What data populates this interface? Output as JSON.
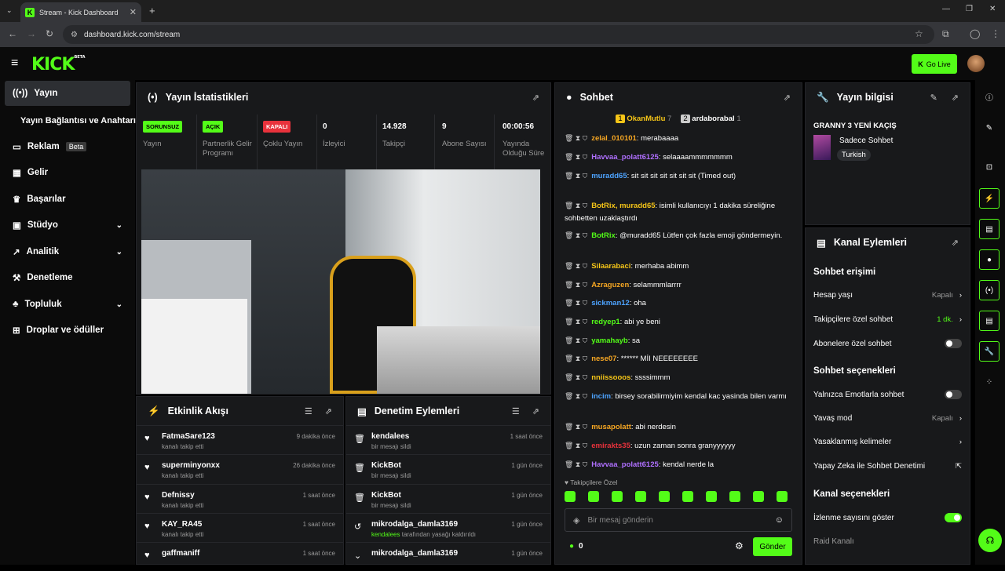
{
  "browser": {
    "tab_title": "Stream - Kick Dashboard",
    "url": "dashboard.kick.com/stream"
  },
  "top": {
    "logo": "KICK",
    "logo_beta": "BETA",
    "go_live": "Go Live"
  },
  "sidebar": {
    "items": [
      {
        "label": "Yayın",
        "icon": "broadcast-icon"
      },
      {
        "label": "Yayın Bağlantısı ve Anahtarı",
        "icon": ""
      },
      {
        "label": "Reklam",
        "icon": "ad-icon",
        "badge": "Beta"
      },
      {
        "label": "Gelir",
        "icon": "revenue-icon"
      },
      {
        "label": "Başarılar",
        "icon": "trophy-icon"
      },
      {
        "label": "Stüdyo",
        "icon": "studio-icon"
      },
      {
        "label": "Analitik",
        "icon": "analytics-icon"
      },
      {
        "label": "Denetleme",
        "icon": "moderation-icon"
      },
      {
        "label": "Topluluk",
        "icon": "community-icon"
      },
      {
        "label": "Droplar ve ödüller",
        "icon": "drops-icon"
      }
    ]
  },
  "stats": {
    "title": "Yayın İstatistikleri",
    "items": [
      {
        "value": "SORUNSUZ",
        "label": "Yayın",
        "color": "#53fc18"
      },
      {
        "value": "AÇIK",
        "label": "Partnerlik Gelir Programı",
        "color": "#53fc18"
      },
      {
        "value": "KAPALI",
        "label": "Çoklu Yayın",
        "color": "#e8323c"
      },
      {
        "value": "0",
        "label": "İzleyici"
      },
      {
        "value": "14.928",
        "label": "Takipçi"
      },
      {
        "value": "9",
        "label": "Abone Sayısı"
      },
      {
        "value": "00:00:56",
        "label": "Yayında Olduğu Süre"
      }
    ]
  },
  "activity": {
    "title": "Etkinlik Akışı",
    "items": [
      {
        "name": "FatmaSare123",
        "sub": "kanalı takip etti",
        "time": "9 dakika önce"
      },
      {
        "name": "superminyonxx",
        "sub": "kanalı takip etti",
        "time": "26 dakika önce"
      },
      {
        "name": "Defnissy",
        "sub": "kanalı takip etti",
        "time": "1 saat önce"
      },
      {
        "name": "KAY_RA45",
        "sub": "kanalı takip etti",
        "time": "1 saat önce"
      },
      {
        "name": "gaffmaniff",
        "sub": "",
        "time": "1 saat önce"
      }
    ]
  },
  "modlog": {
    "title": "Denetim Eylemleri",
    "items": [
      {
        "name": "kendalees",
        "sub": "bir mesajı sildi",
        "time": "1 saat önce"
      },
      {
        "name": "KickBot",
        "sub": "bir mesajı sildi",
        "time": "1 gün önce"
      },
      {
        "name": "KickBot",
        "sub": "bir mesajı sildi",
        "time": "1 gün önce"
      },
      {
        "name": "mikrodalga_damla3169",
        "sub_user": "kendalees",
        "sub": "tarafından yasağı kaldırıldı",
        "time": "1 gün önce"
      },
      {
        "name": "mikrodalga_damla3169",
        "sub": "",
        "time": "1 gün önce"
      }
    ]
  },
  "chat": {
    "title": "Sohbet",
    "pinned": [
      {
        "name": "OkanMutlu",
        "count": "7"
      },
      {
        "name": "ardaborabal",
        "count": "1"
      }
    ],
    "messages": [
      {
        "user": "zelal_010101",
        "color": "#f5a623",
        "text": "merabaaaa"
      },
      {
        "user": "Havvaa_polatt6125",
        "color": "#b070ff",
        "text": "selaaaammmmmmm"
      },
      {
        "user": "muradd65",
        "color": "#4da3ff",
        "text": "sit sit sit sit sit sit sit (Timed out)"
      },
      {
        "user": "BotRix, muradd65",
        "color": "#f5c518",
        "text": "isimli kullanıcıyı 1 dakika süreliğine sohbetten uzaklaştırdı"
      },
      {
        "user": "BotRix",
        "color": "#53fc18",
        "text": "@muradd65 Lütfen çok fazla emoji göndermeyin."
      },
      {
        "user": "Silaarabaci",
        "color": "#f5c518",
        "text": "merhaba abimm"
      },
      {
        "user": "Azraguzen",
        "color": "#f5a623",
        "text": "selammmlarrrr"
      },
      {
        "user": "sickman12",
        "color": "#4da3ff",
        "text": "oha"
      },
      {
        "user": "redyep1",
        "color": "#53fc18",
        "text": "abi ye beni"
      },
      {
        "user": "yamahayb",
        "color": "#53fc18",
        "text": "sa"
      },
      {
        "user": "nese07",
        "color": "#f5a623",
        "text": "****** MİI NEEEEEEEE"
      },
      {
        "user": "nniissooos",
        "color": "#f5c518",
        "text": "ssssimmm"
      },
      {
        "user": "incim",
        "color": "#4da3ff",
        "text": "birsey sorabilirmiyim kendal kac yasinda bilen varmı"
      },
      {
        "user": "musapolatt",
        "color": "#f5a623",
        "text": "abi nerdesin"
      },
      {
        "user": "emirakts35",
        "color": "#e8323c",
        "text": "uzun zaman sonra granyyyyyy"
      },
      {
        "user": "Havvaa_polatt6125",
        "color": "#b070ff",
        "text": "kendal nerde la"
      }
    ],
    "followers_only": "Takipçilere Özel",
    "placeholder": "Bir mesaj gönderin",
    "count": "0",
    "send": "Gönder"
  },
  "info": {
    "title": "Yayın bilgisi",
    "stream_title": "GRANNY 3 YENİ KAÇIŞ",
    "category": "Sadece Sohbet",
    "language": "Turkish"
  },
  "actions": {
    "title": "Kanal Eylemleri",
    "chat_access": "Sohbet erişimi",
    "account_age": "Hesap yaşı",
    "account_age_val": "Kapalı",
    "followers_chat": "Takipçilere özel sohbet",
    "followers_chat_val": "1 dk.",
    "subs_chat": "Abonelere özel sohbet",
    "chat_options": "Sohbet seçenekleri",
    "emote_only": "Yalnızca Emotlarla sohbet",
    "slow_mode": "Yavaş mod",
    "slow_mode_val": "Kapalı",
    "banned_words": "Yasaklanmış kelimeler",
    "ai_mod": "Yapay Zeka ile Sohbet Denetimi",
    "channel_options": "Kanal seçenekleri",
    "show_viewers": "İzlenme sayısını göster",
    "raid": "Raid Kanalı"
  }
}
